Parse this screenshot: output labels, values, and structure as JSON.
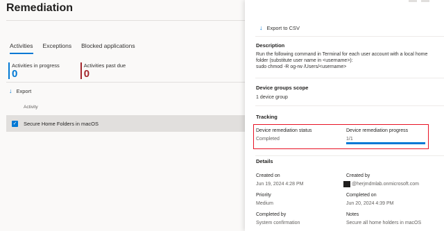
{
  "page": {
    "title": "Remediation",
    "tabs": [
      "Activities",
      "Exceptions",
      "Blocked applications"
    ],
    "kpis": [
      {
        "label": "Activities in progress",
        "value": "0"
      },
      {
        "label": "Activities past due",
        "value": "0"
      }
    ],
    "export_label": "Export",
    "table": {
      "column": "Activity",
      "rows": [
        {
          "label": "Secure Home Folders in macOS",
          "checked": true
        }
      ]
    }
  },
  "panel": {
    "export_label": "Export to CSV",
    "description_title": "Description",
    "description_lines": [
      "Run the following command in Terminal for each user account with a local home",
      "folder (substitute user name in <username>):",
      "sudo chmod -R og-rw /Users/<username>"
    ],
    "device_groups_title": "Device groups scope",
    "device_groups_value": "1 device group",
    "tracking_title": "Tracking",
    "status_label": "Device remediation status",
    "status_value": "Completed",
    "progress_label": "Device remediation progress",
    "progress_value": "1/1",
    "progress_fraction": 1.0,
    "details_title": "Details",
    "created_on_label": "Created on",
    "created_on_value": "Jun 19, 2024 4:28 PM",
    "created_by_label": "Created by",
    "created_by_value": "@herjmdmlab.onmicrosoft.com",
    "priority_label": "Priority",
    "priority_value": "Medium",
    "completed_on_label": "Completed on",
    "completed_on_value": "Jun 20, 2024 4:39 PM",
    "completed_by_label": "Completed by",
    "completed_by_value": "System confirmation",
    "notes_label": "Notes",
    "notes_value": "Secure all home holders in macOS"
  },
  "colors": {
    "accent": "#0078d4",
    "past_due": "#a4262c",
    "highlight": "#e81123"
  },
  "icons": {
    "export": "download-arrow-icon",
    "checkbox": "checkmark-icon",
    "avatar": "user-avatar-icon"
  }
}
